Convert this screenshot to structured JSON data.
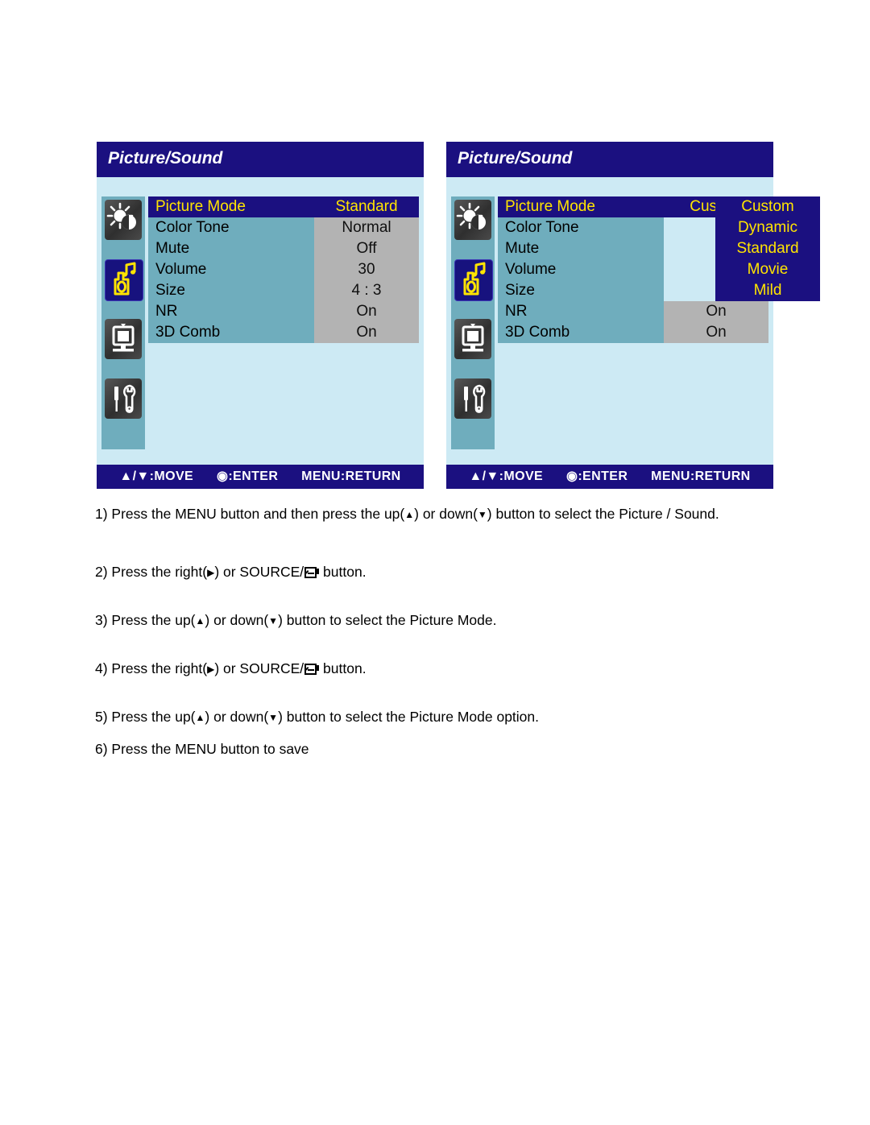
{
  "panels": [
    {
      "id": "left",
      "title": "Picture/Sound",
      "rows": [
        {
          "label": "Picture Mode",
          "value": "Standard",
          "highlight": true
        },
        {
          "label": "Color Tone",
          "value": "Normal",
          "highlight": false
        },
        {
          "label": "Mute",
          "value": "Off",
          "highlight": false
        },
        {
          "label": "Volume",
          "value": "30",
          "highlight": false
        },
        {
          "label": "Size",
          "value": "4 : 3",
          "highlight": false
        },
        {
          "label": "NR",
          "value": "On",
          "highlight": false
        },
        {
          "label": "3D Comb",
          "value": "On",
          "highlight": false
        }
      ],
      "dropdown": null,
      "footer": {
        "move": "▲/▼:MOVE",
        "enter": "◉:ENTER",
        "return": "MENU:RETURN"
      }
    },
    {
      "id": "right",
      "title": "Picture/Sound",
      "rows": [
        {
          "label": "Picture Mode",
          "value": "Custom",
          "highlight": true
        },
        {
          "label": "Color Tone",
          "value": "",
          "highlight": false
        },
        {
          "label": "Mute",
          "value": "",
          "highlight": false
        },
        {
          "label": "Volume",
          "value": "",
          "highlight": false
        },
        {
          "label": "Size",
          "value": "",
          "highlight": false
        },
        {
          "label": "NR",
          "value": "On",
          "highlight": false
        },
        {
          "label": "3D Comb",
          "value": "On",
          "highlight": false
        }
      ],
      "dropdown": {
        "options": [
          "Custom",
          "Dynamic",
          "Standard",
          "Movie",
          "Mild"
        ]
      },
      "footer": {
        "move": "▲/▼:MOVE",
        "enter": "◉:ENTER",
        "return": "MENU:RETURN"
      }
    }
  ],
  "icons": [
    {
      "name": "brightness-contrast-icon",
      "selected": false
    },
    {
      "name": "sound-icon",
      "selected": true
    },
    {
      "name": "setup-monitor-icon",
      "selected": false
    },
    {
      "name": "tools-icon",
      "selected": false
    }
  ],
  "steps": [
    {
      "id": 1,
      "parts": [
        {
          "t": "text",
          "v": "1) Press the MENU button and then press the up("
        },
        {
          "t": "up"
        },
        {
          "t": "text",
          "v": ") or down("
        },
        {
          "t": "down"
        },
        {
          "t": "text",
          "v": ") button to select the Picture / Sound."
        }
      ]
    },
    {
      "id": 2,
      "parts": [
        {
          "t": "text",
          "v": "2) Press the right("
        },
        {
          "t": "right"
        },
        {
          "t": "text",
          "v": ") or SOURCE/"
        },
        {
          "t": "source"
        },
        {
          "t": "text",
          "v": "  button."
        }
      ]
    },
    {
      "id": 3,
      "parts": [
        {
          "t": "text",
          "v": "3) Press the up("
        },
        {
          "t": "up"
        },
        {
          "t": "text",
          "v": ") or down("
        },
        {
          "t": "down"
        },
        {
          "t": "text",
          "v": ") button to select the Picture Mode."
        }
      ]
    },
    {
      "id": 4,
      "parts": [
        {
          "t": "text",
          "v": "4) Press the right("
        },
        {
          "t": "right"
        },
        {
          "t": "text",
          "v": ") or SOURCE/"
        },
        {
          "t": "source"
        },
        {
          "t": "text",
          "v": "  button."
        }
      ]
    },
    {
      "id": 5,
      "parts": [
        {
          "t": "text",
          "v": "5) Press the up("
        },
        {
          "t": "up"
        },
        {
          "t": "text",
          "v": ") or down("
        },
        {
          "t": "down"
        },
        {
          "t": "text",
          "v": ") button to select the Picture Mode option."
        }
      ]
    },
    {
      "id": 6,
      "parts": [
        {
          "t": "text",
          "v": "6) Press the MENU button to save"
        }
      ]
    }
  ],
  "step_offsets": [
    0,
    72,
    132,
    192,
    252,
    292
  ],
  "colors": {
    "osd_navy": "#1b1080",
    "osd_teal": "#6fadbd",
    "osd_light": "#cdeaf4",
    "osd_gray": "#b3b3b3",
    "osd_yellow": "#ffe400",
    "osd_white": "#ffffff"
  }
}
